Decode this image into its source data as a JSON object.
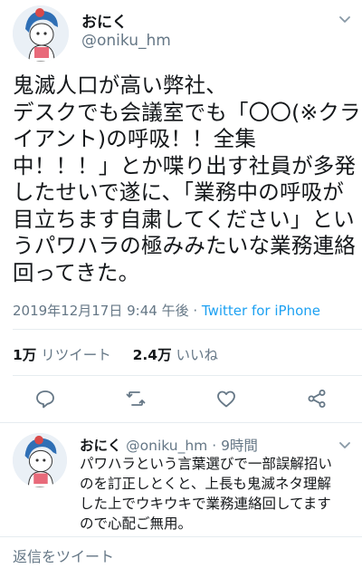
{
  "tweet": {
    "display_name": "おにく",
    "handle": "@oniku_hm",
    "text_lines": [
      "鬼滅人口が高い弊社、",
      "デスクでも会議室でも「〇〇(※クラ",
      "イアント)の呼吸！！全集",
      "中！！！」とか喋り出す社員が多発",
      "したせいで遂に、「業務中の呼吸が",
      "目立ちます自粛してください」とい",
      "うパワハラの極みみたいな業務連絡",
      "回ってきた。"
    ],
    "timestamp": "2019年12月17日 9:44 午後",
    "separator": "·",
    "source": "Twitter for iPhone"
  },
  "stats": {
    "retweets_count": "1万",
    "retweets_label": "リツイート",
    "likes_count": "2.4万",
    "likes_label": "いいね"
  },
  "actions": {
    "icons": [
      "reply-icon",
      "retweet-icon",
      "like-icon",
      "share-icon"
    ]
  },
  "reply": {
    "display_name": "おにく",
    "handle": "@oniku_hm",
    "separator": "·",
    "time": "9時間",
    "text_lines": [
      "パワハラという言葉選びで一部誤解招い",
      "のを訂正しとくと、上長も鬼滅ネタ理解",
      "した上でウキウキで業務連絡回してます",
      "ので心配ご無用。"
    ]
  },
  "composer": {
    "placeholder": "返信をツイート"
  },
  "colors": {
    "link": "#1da1f2",
    "secondary_text": "#657786",
    "divider": "#e6ecf0",
    "icon": "#657786"
  }
}
